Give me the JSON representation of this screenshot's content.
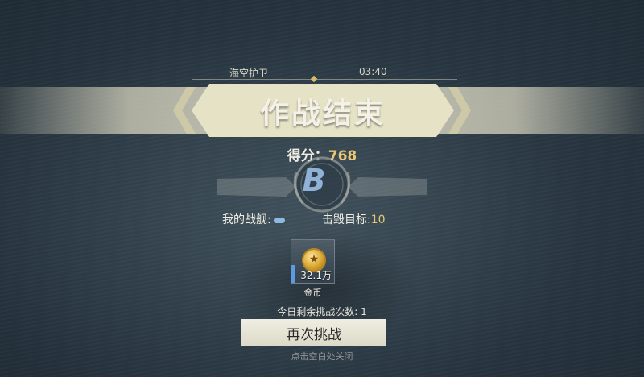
{
  "header": {
    "mode_name": "海空护卫",
    "timer": "03:40"
  },
  "banner": {
    "title": "作战结束"
  },
  "score": {
    "label": "得分：",
    "value": "768"
  },
  "rank": {
    "grade": "B"
  },
  "stats": {
    "ship_label": "我的战舰:",
    "ship_icon": "ship-icon",
    "destroyed_label": "击毁目标:",
    "destroyed_value": "10"
  },
  "reward": {
    "icon": "gold-coin-icon",
    "amount": "32.1万",
    "name": "金币"
  },
  "challenge": {
    "remaining_text": "今日剩余挑战次数: 1",
    "retry_label": "再次挑战"
  },
  "hint": {
    "text": "点击空白处关闭"
  },
  "colors": {
    "accent_gold": "#e8c774",
    "rank_blue": "#8fb2d6",
    "banner": "#e6e2c6"
  }
}
